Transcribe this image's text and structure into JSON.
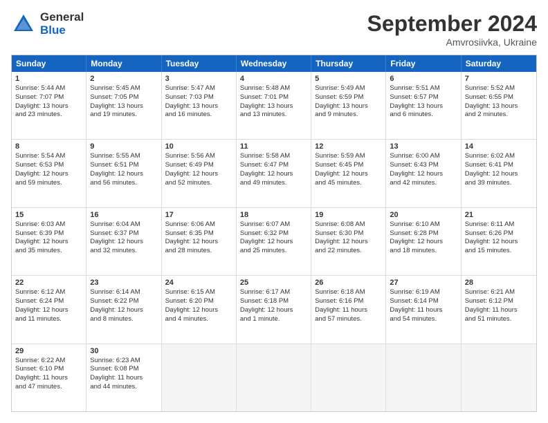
{
  "logo": {
    "general": "General",
    "blue": "Blue"
  },
  "title": "September 2024",
  "subtitle": "Amvrosiivka, Ukraine",
  "header_days": [
    "Sunday",
    "Monday",
    "Tuesday",
    "Wednesday",
    "Thursday",
    "Friday",
    "Saturday"
  ],
  "rows": [
    [
      {
        "day": "",
        "lines": [],
        "empty": true
      },
      {
        "day": "",
        "lines": [],
        "empty": true
      },
      {
        "day": "",
        "lines": [],
        "empty": true
      },
      {
        "day": "",
        "lines": [],
        "empty": true
      },
      {
        "day": "",
        "lines": [],
        "empty": true
      },
      {
        "day": "",
        "lines": [],
        "empty": true
      },
      {
        "day": "",
        "lines": [],
        "empty": true
      }
    ],
    [
      {
        "day": "1",
        "lines": [
          "Sunrise: 5:44 AM",
          "Sunset: 7:07 PM",
          "Daylight: 13 hours",
          "and 23 minutes."
        ]
      },
      {
        "day": "2",
        "lines": [
          "Sunrise: 5:45 AM",
          "Sunset: 7:05 PM",
          "Daylight: 13 hours",
          "and 19 minutes."
        ]
      },
      {
        "day": "3",
        "lines": [
          "Sunrise: 5:47 AM",
          "Sunset: 7:03 PM",
          "Daylight: 13 hours",
          "and 16 minutes."
        ]
      },
      {
        "day": "4",
        "lines": [
          "Sunrise: 5:48 AM",
          "Sunset: 7:01 PM",
          "Daylight: 13 hours",
          "and 13 minutes."
        ]
      },
      {
        "day": "5",
        "lines": [
          "Sunrise: 5:49 AM",
          "Sunset: 6:59 PM",
          "Daylight: 13 hours",
          "and 9 minutes."
        ]
      },
      {
        "day": "6",
        "lines": [
          "Sunrise: 5:51 AM",
          "Sunset: 6:57 PM",
          "Daylight: 13 hours",
          "and 6 minutes."
        ]
      },
      {
        "day": "7",
        "lines": [
          "Sunrise: 5:52 AM",
          "Sunset: 6:55 PM",
          "Daylight: 13 hours",
          "and 2 minutes."
        ]
      }
    ],
    [
      {
        "day": "8",
        "lines": [
          "Sunrise: 5:54 AM",
          "Sunset: 6:53 PM",
          "Daylight: 12 hours",
          "and 59 minutes."
        ]
      },
      {
        "day": "9",
        "lines": [
          "Sunrise: 5:55 AM",
          "Sunset: 6:51 PM",
          "Daylight: 12 hours",
          "and 56 minutes."
        ]
      },
      {
        "day": "10",
        "lines": [
          "Sunrise: 5:56 AM",
          "Sunset: 6:49 PM",
          "Daylight: 12 hours",
          "and 52 minutes."
        ]
      },
      {
        "day": "11",
        "lines": [
          "Sunrise: 5:58 AM",
          "Sunset: 6:47 PM",
          "Daylight: 12 hours",
          "and 49 minutes."
        ]
      },
      {
        "day": "12",
        "lines": [
          "Sunrise: 5:59 AM",
          "Sunset: 6:45 PM",
          "Daylight: 12 hours",
          "and 45 minutes."
        ]
      },
      {
        "day": "13",
        "lines": [
          "Sunrise: 6:00 AM",
          "Sunset: 6:43 PM",
          "Daylight: 12 hours",
          "and 42 minutes."
        ]
      },
      {
        "day": "14",
        "lines": [
          "Sunrise: 6:02 AM",
          "Sunset: 6:41 PM",
          "Daylight: 12 hours",
          "and 39 minutes."
        ]
      }
    ],
    [
      {
        "day": "15",
        "lines": [
          "Sunrise: 6:03 AM",
          "Sunset: 6:39 PM",
          "Daylight: 12 hours",
          "and 35 minutes."
        ]
      },
      {
        "day": "16",
        "lines": [
          "Sunrise: 6:04 AM",
          "Sunset: 6:37 PM",
          "Daylight: 12 hours",
          "and 32 minutes."
        ]
      },
      {
        "day": "17",
        "lines": [
          "Sunrise: 6:06 AM",
          "Sunset: 6:35 PM",
          "Daylight: 12 hours",
          "and 28 minutes."
        ]
      },
      {
        "day": "18",
        "lines": [
          "Sunrise: 6:07 AM",
          "Sunset: 6:32 PM",
          "Daylight: 12 hours",
          "and 25 minutes."
        ]
      },
      {
        "day": "19",
        "lines": [
          "Sunrise: 6:08 AM",
          "Sunset: 6:30 PM",
          "Daylight: 12 hours",
          "and 22 minutes."
        ]
      },
      {
        "day": "20",
        "lines": [
          "Sunrise: 6:10 AM",
          "Sunset: 6:28 PM",
          "Daylight: 12 hours",
          "and 18 minutes."
        ]
      },
      {
        "day": "21",
        "lines": [
          "Sunrise: 6:11 AM",
          "Sunset: 6:26 PM",
          "Daylight: 12 hours",
          "and 15 minutes."
        ]
      }
    ],
    [
      {
        "day": "22",
        "lines": [
          "Sunrise: 6:12 AM",
          "Sunset: 6:24 PM",
          "Daylight: 12 hours",
          "and 11 minutes."
        ]
      },
      {
        "day": "23",
        "lines": [
          "Sunrise: 6:14 AM",
          "Sunset: 6:22 PM",
          "Daylight: 12 hours",
          "and 8 minutes."
        ]
      },
      {
        "day": "24",
        "lines": [
          "Sunrise: 6:15 AM",
          "Sunset: 6:20 PM",
          "Daylight: 12 hours",
          "and 4 minutes."
        ]
      },
      {
        "day": "25",
        "lines": [
          "Sunrise: 6:17 AM",
          "Sunset: 6:18 PM",
          "Daylight: 12 hours",
          "and 1 minute."
        ]
      },
      {
        "day": "26",
        "lines": [
          "Sunrise: 6:18 AM",
          "Sunset: 6:16 PM",
          "Daylight: 11 hours",
          "and 57 minutes."
        ]
      },
      {
        "day": "27",
        "lines": [
          "Sunrise: 6:19 AM",
          "Sunset: 6:14 PM",
          "Daylight: 11 hours",
          "and 54 minutes."
        ]
      },
      {
        "day": "28",
        "lines": [
          "Sunrise: 6:21 AM",
          "Sunset: 6:12 PM",
          "Daylight: 11 hours",
          "and 51 minutes."
        ]
      }
    ],
    [
      {
        "day": "29",
        "lines": [
          "Sunrise: 6:22 AM",
          "Sunset: 6:10 PM",
          "Daylight: 11 hours",
          "and 47 minutes."
        ]
      },
      {
        "day": "30",
        "lines": [
          "Sunrise: 6:23 AM",
          "Sunset: 6:08 PM",
          "Daylight: 11 hours",
          "and 44 minutes."
        ]
      },
      {
        "day": "",
        "lines": [],
        "empty": true
      },
      {
        "day": "",
        "lines": [],
        "empty": true
      },
      {
        "day": "",
        "lines": [],
        "empty": true
      },
      {
        "day": "",
        "lines": [],
        "empty": true
      },
      {
        "day": "",
        "lines": [],
        "empty": true
      }
    ]
  ]
}
